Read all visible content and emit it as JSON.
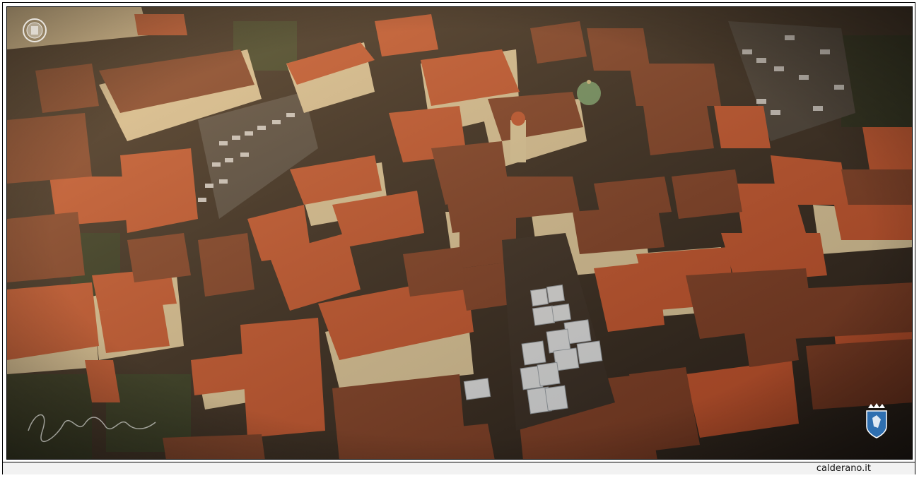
{
  "footer": {
    "site_label": "calderano.it"
  },
  "watermarks": {
    "top_left_icon": "crest-seal-icon",
    "bottom_right_icon": "coat-of-arms-icon",
    "signature_icon": "handwritten-signature-icon"
  },
  "colors": {
    "frame": "#000000",
    "footer_bg": "#f2f2f2",
    "roof_terracotta": "#c8512a",
    "roof_dark": "#7a3420",
    "wall_cream": "#e6d3a8",
    "street_shadow": "#2a1f18",
    "umbrella_white": "#e8eef4",
    "dome_green": "#6f9a6a",
    "crest_blue": "#2f6fb0"
  }
}
